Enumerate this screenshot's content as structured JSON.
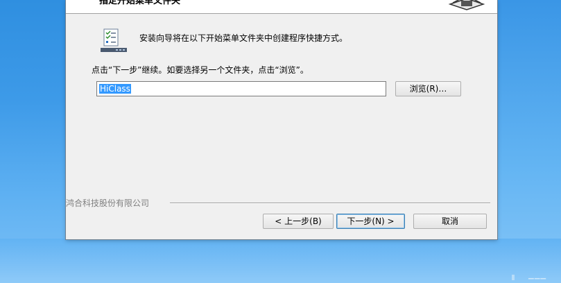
{
  "window": {
    "header_title": "指定开始菜单文件夹",
    "intro": "安装向导将在以下开始菜单文件夹中创建程序快捷方式。",
    "hint": "点击“下一步”继续。如要选择另一个文件夹，点击“浏览”。",
    "folder_value": "HiClass",
    "browse_label": "浏览(R)…",
    "branding": "鸿合科技股份有限公司",
    "back_label": "< 上一步(B)",
    "next_label": "下一步(N) >",
    "cancel_label": "取消"
  },
  "icons": {
    "folder": "start-menu-folder-icon",
    "logo": "installer-logo-icon"
  },
  "colors": {
    "desktop": "#3d9ae8",
    "window_bg": "#f0f0f0",
    "selection": "#3399ff",
    "default_button_border": "#3c7fb1"
  }
}
